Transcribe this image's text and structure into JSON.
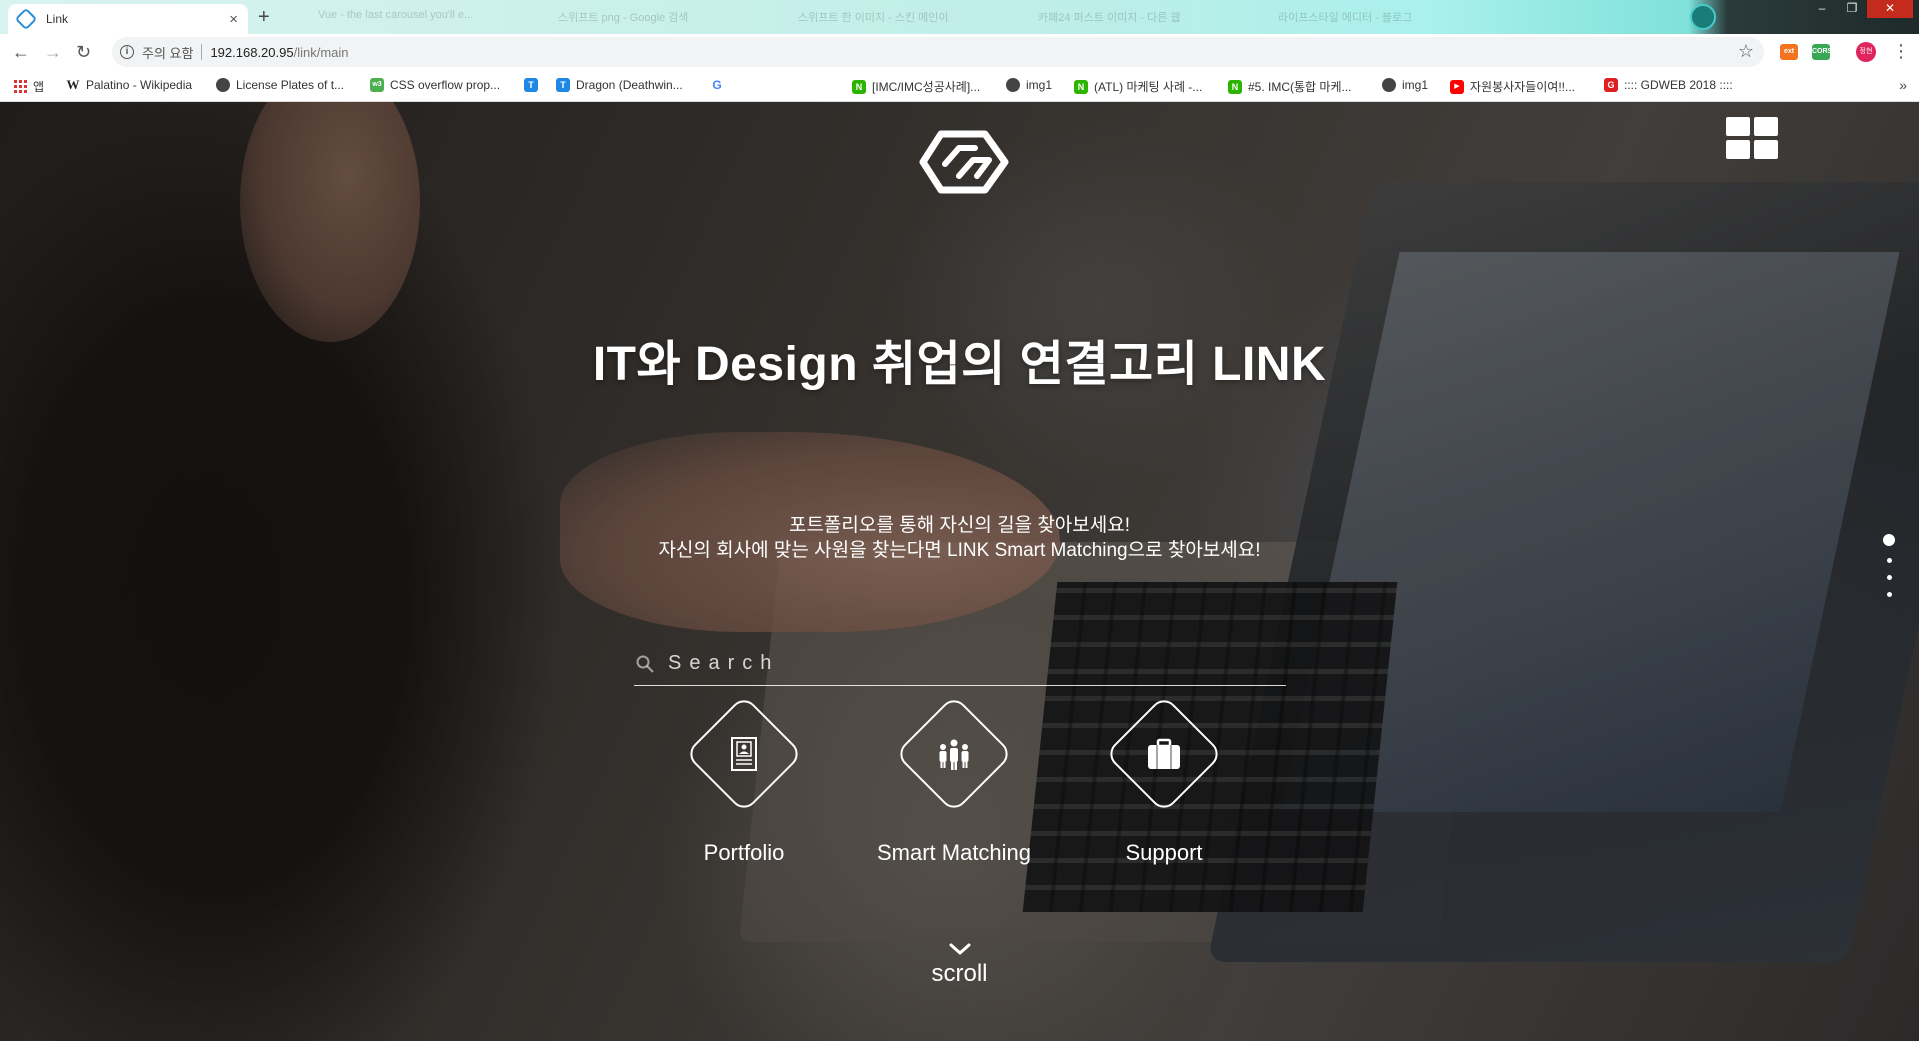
{
  "browser": {
    "tab_title": "Link",
    "tab_close": "×",
    "new_tab": "+",
    "ghost_tabs": [
      "Vue - the last carousel you'll e...",
      "스위프트 png - Google 검색",
      "스위프트 한 이미지 - 스킨 메인이",
      "카페24 퍼스트 이미지 - 다른 웹",
      "라이프스타일 에디터 - 블로그",
      ""
    ],
    "security_label": "주의 요함",
    "url_host": "192.168.20.95",
    "url_path": "/link/main",
    "extensions": [
      {
        "name": "ext-orange-icon",
        "label": "ext",
        "color": "#f47321"
      },
      {
        "name": "ext-green-icon",
        "label": "CORS",
        "color": "#3aa757"
      }
    ],
    "profile_label": "정현"
  },
  "bookmarks": [
    {
      "name": "bookmark-apps",
      "label": "앱",
      "icon": "apps-icon"
    },
    {
      "name": "bookmark-palatino",
      "label": "Palatino - Wikipedia",
      "icon": "W",
      "color": "#222"
    },
    {
      "name": "bookmark-license-plates",
      "label": "License Plates of t...",
      "icon": "globe",
      "color": "#333"
    },
    {
      "name": "bookmark-css-overflow",
      "label": "CSS overflow prop...",
      "icon": "w3",
      "color": "#4caf50"
    },
    {
      "name": "bookmark-blue",
      "label": "",
      "icon": "T",
      "color": "#1e88e5"
    },
    {
      "name": "bookmark-dragon",
      "label": "Dragon (Deathwin...",
      "icon": "T",
      "color": "#1e88e5"
    },
    {
      "name": "bookmark-google",
      "label": "",
      "icon": "G",
      "color": "#4285f4"
    },
    {
      "name": "bookmark-imc-success",
      "label": "[IMC/IMC성공사례]...",
      "icon": "N",
      "color": "#2db400"
    },
    {
      "name": "bookmark-img1-a",
      "label": "img1",
      "icon": "globe",
      "color": "#333"
    },
    {
      "name": "bookmark-atl",
      "label": "(ATL) 마케팅 사례 -...",
      "icon": "N",
      "color": "#2db400"
    },
    {
      "name": "bookmark-imc5",
      "label": "#5. IMC(통합 마케...",
      "icon": "N",
      "color": "#2db400"
    },
    {
      "name": "bookmark-img1-b",
      "label": "img1",
      "icon": "globe",
      "color": "#333"
    },
    {
      "name": "bookmark-volunteer",
      "label": "자원봉사자들이여!!...",
      "icon": "▶",
      "color": "#ff0000"
    },
    {
      "name": "bookmark-gdweb",
      "label": ":::: GDWEB 2018 ::::",
      "icon": "G",
      "color": "#e02020"
    }
  ],
  "bookmarks_more": "»",
  "page": {
    "headline": "IT와 Design 취업의 연결고리 LINK",
    "sub1": "포트폴리오를 통해 자신의 길을 찾아보세요!",
    "sub2": "자신의 회사에 맞는 사원을 찾는다면 LINK Smart Matching으로 찾아보세요!",
    "search_placeholder": "Search",
    "features": [
      {
        "label": "Portfolio",
        "icon": "resume-icon"
      },
      {
        "label": "Smart Matching",
        "icon": "people-icon"
      },
      {
        "label": "Support",
        "icon": "briefcase-icon"
      }
    ],
    "scroll_label": "scroll",
    "page_dots": 4,
    "active_dot": 0
  }
}
